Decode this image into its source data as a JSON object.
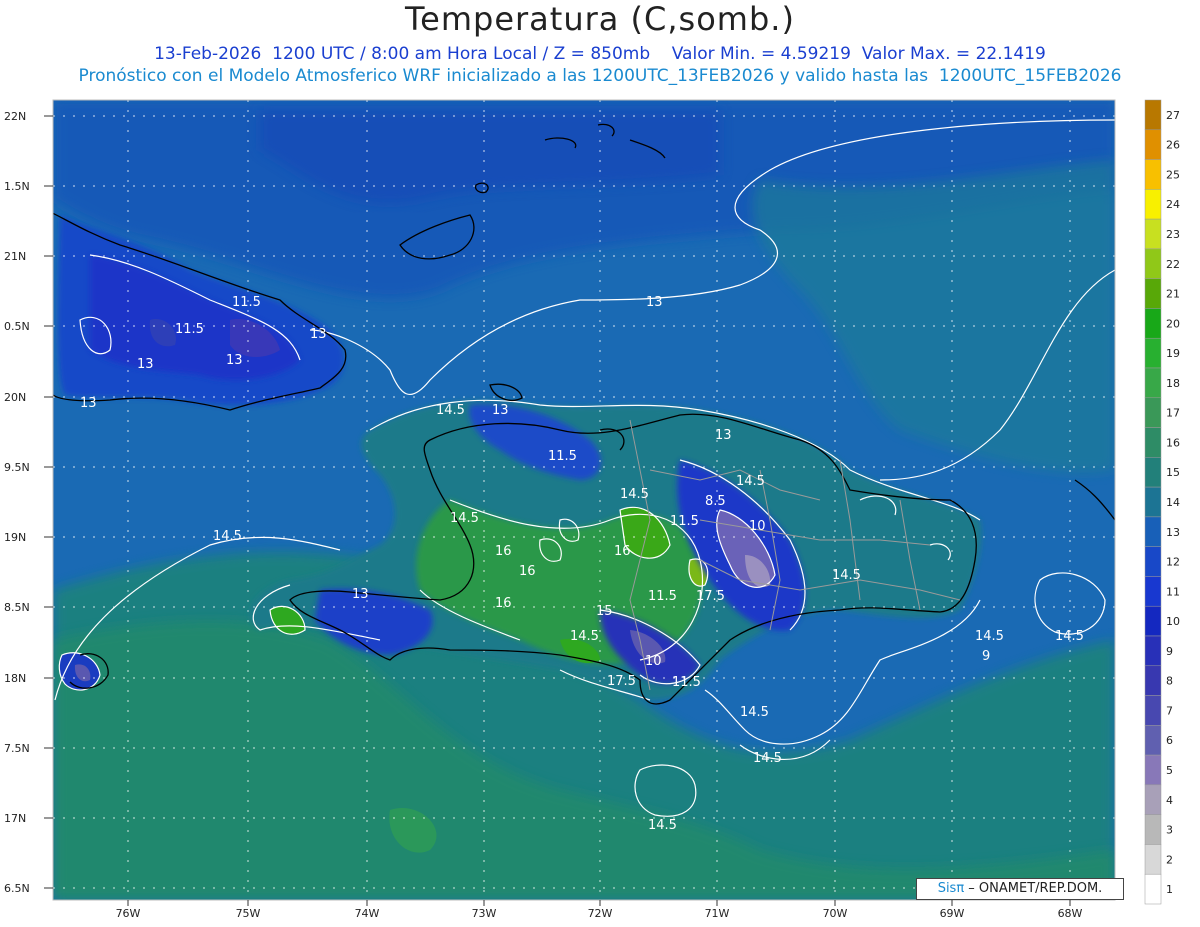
{
  "header": {
    "title": "Temperatura (C,somb.)",
    "line1": "13-Feb-2026  1200 UTC / 8:00 am Hora Local / Z = 850mb    Valor Min. = 4.59219  Valor Max. = 22.1419",
    "line2": "Pronóstico con el Modelo Atmosferico WRF inicializado a las 1200UTC_13FEB2026 y valido hasta las  1200UTC_15FEB2026"
  },
  "axes": {
    "lat_labels": [
      "22N",
      "1.5N",
      "21N",
      "0.5N",
      "20N",
      "9.5N",
      "19N",
      "8.5N",
      "18N",
      "7.5N",
      "17N",
      "6.5N"
    ],
    "lon_labels": [
      "76W",
      "75W",
      "74W",
      "73W",
      "72W",
      "71W",
      "70W",
      "69W",
      "68W"
    ]
  },
  "colorbar": {
    "levels": [
      "27",
      "26",
      "25",
      "24",
      "23",
      "22",
      "21",
      "20",
      "19",
      "18",
      "17",
      "16",
      "15",
      "14",
      "13",
      "12",
      "11",
      "10",
      "9",
      "8",
      "7",
      "6",
      "5",
      "4",
      "3",
      "2",
      "1"
    ],
    "colors": [
      "#b87800",
      "#e09000",
      "#f8c000",
      "#f8f000",
      "#c8e020",
      "#90c818",
      "#58a808",
      "#18a818",
      "#28b030",
      "#38a848",
      "#3a9858",
      "#2e8c66",
      "#22807a",
      "#1c7494",
      "#1860b8",
      "#1848c8",
      "#1838d0",
      "#1428c0",
      "#2830b8",
      "#3838b0",
      "#4848b0",
      "#6060b0",
      "#8878b8",
      "#a8a0b8",
      "#b8b8b8",
      "#d8d8d8",
      "#ffffff"
    ]
  },
  "contour_labels": [
    "11.5",
    "11.5",
    "13",
    "13",
    "13",
    "13",
    "13",
    "14.5",
    "13",
    "11.5",
    "14.5",
    "13",
    "14.5",
    "8.5",
    "10",
    "14.5",
    "16",
    "16",
    "11.5",
    "16",
    "11.5",
    "17.5",
    "14.5",
    "16",
    "15",
    "14.5",
    "10",
    "11.5",
    "17.5",
    "14.5",
    "14.5",
    "14.5",
    "14.5",
    "14.5",
    "9",
    "13",
    "14.5"
  ],
  "credit": {
    "sis": "Sisπ",
    "rest": " – ONAMET/REP.DOM."
  },
  "colors": {
    "ocean": "#1c68b0",
    "land_low": "#1850c0",
    "green": "#2aa030"
  }
}
